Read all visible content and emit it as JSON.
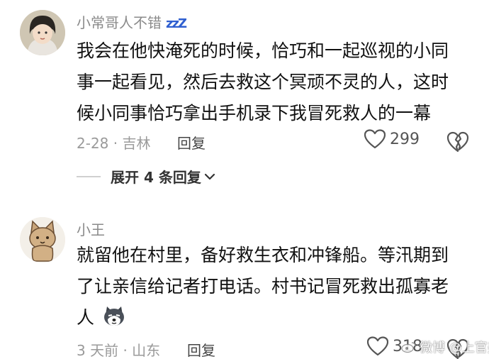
{
  "comments": [
    {
      "username": "小常哥人不错",
      "badge": "zzZ",
      "text_lines": [
        "我会在他快淹死的时候，恰巧和一起巡视的小同",
        "事一起看见，然后去救这个冥顽不灵的人，这时",
        "候小同事恰巧拿出手机录下我冒死救人的一幕"
      ],
      "meta": "2-28 · 吉林",
      "reply_label": "回复",
      "like_count": "299",
      "expand_label": "展开 4 条回复",
      "avatar_icon": "girl-avatar"
    },
    {
      "username": "小王",
      "text_lines": [
        "就留他在村里，备好救生衣和冲锋船。等汛期到",
        "了让亲信给记者打电话。村书记冒死救出孤寡老",
        "人"
      ],
      "meta": "3 天前 · 山东",
      "reply_label": "回复",
      "like_count": "318",
      "avatar_icon": "cat-avatar"
    }
  ],
  "watermark": "微博 @上官美娱",
  "colors": {
    "badge_blue": "#2f5fd0",
    "meta_gray": "#9a9a9a",
    "text": "#111111"
  }
}
